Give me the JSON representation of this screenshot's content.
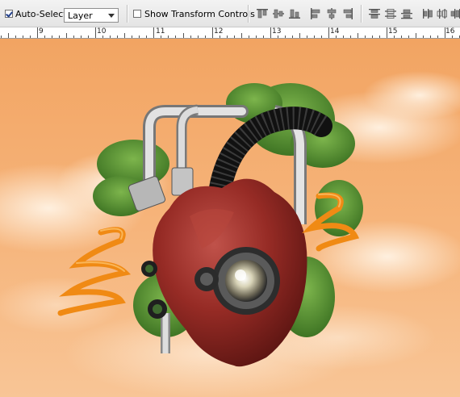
{
  "toolbar": {
    "auto_select": {
      "label": "Auto-Select:",
      "checked": true
    },
    "layer_select": {
      "value": "Layer"
    },
    "show_transform": {
      "label": "Show Transform Controls",
      "checked": false
    },
    "align_buttons": [
      "align-top-edges-icon",
      "align-vertical-centers-icon",
      "align-bottom-edges-icon",
      "align-left-edges-icon",
      "align-horizontal-centers-icon",
      "align-right-edges-icon",
      "distribute-top-edges-icon",
      "distribute-vertical-centers-icon",
      "distribute-bottom-edges-icon",
      "distribute-left-edges-icon",
      "distribute-horizontal-centers-icon",
      "distribute-right-edges-icon"
    ]
  },
  "ruler": {
    "labels": [
      "9",
      "10",
      "11",
      "12",
      "13",
      "14",
      "15",
      "16"
    ]
  },
  "canvas": {
    "artwork": "mechanical-heart-artwork",
    "colors": {
      "sky_top": "#f2a868",
      "sky_bottom": "#f7c08e",
      "heart": "#8d2620",
      "foliage": "#4f8a2c",
      "coil": "#f08a14",
      "pipe": "#c9c9c9"
    }
  }
}
